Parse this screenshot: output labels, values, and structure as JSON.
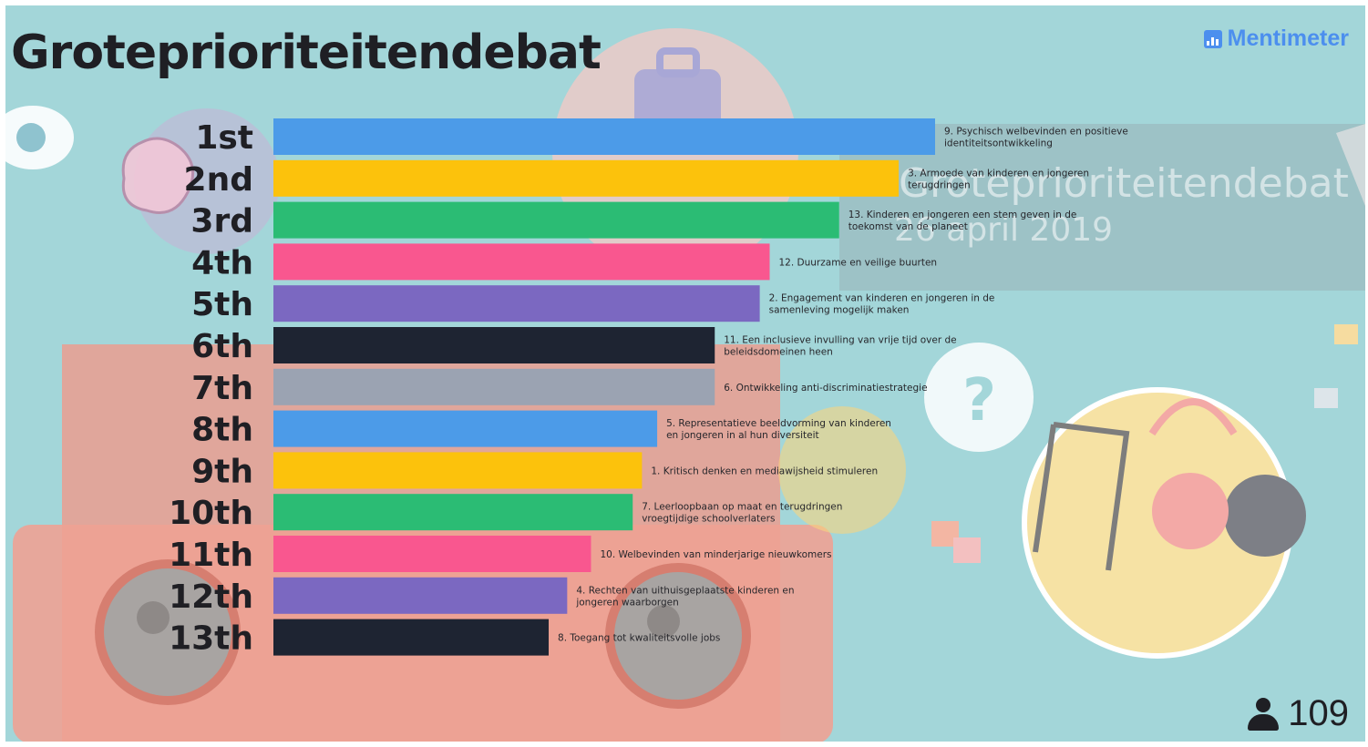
{
  "slide": {
    "title": "Groteprioriteitendebat",
    "background_title": "Groteprioriteitendebat",
    "background_date": "26 april 2019"
  },
  "branding": {
    "logo_text": "Mentimeter",
    "logo_icon": "bar-chart-icon",
    "color": "#4c8fee"
  },
  "participants": {
    "icon": "user-icon",
    "count": "109"
  },
  "chart_data": {
    "type": "bar",
    "orientation": "horizontal",
    "title": "Groteprioriteitendebat",
    "categories": [
      "1st",
      "2nd",
      "3rd",
      "4th",
      "5th",
      "6th",
      "7th",
      "8th",
      "9th",
      "10th",
      "11th",
      "12th",
      "13th"
    ],
    "labels": [
      [
        "9. Psychisch welbevinden en positieve",
        "identiteitsontwikkeling"
      ],
      [
        "3. Armoede van kinderen en jongeren",
        "terugdringen"
      ],
      [
        "13. Kinderen en jongeren een stem geven in de",
        "toekomst van de planeet"
      ],
      [
        "12. Duurzame en veilige buurten"
      ],
      [
        "2. Engagement van kinderen en jongeren in de",
        "samenleving mogelijk maken"
      ],
      [
        "11. Een inclusieve invulling van vrije tijd over de",
        "beleidsdomeinen heen"
      ],
      [
        "6. Ontwikkeling anti-discriminatiestrategie"
      ],
      [
        "5. Representatieve beeldvorming van kinderen",
        "en jongeren in al hun diversiteit"
      ],
      [
        "1. Kritisch denken en mediawijsheid stimuleren"
      ],
      [
        "7. Leerloopbaan op maat en terugdringen",
        "vroegtijdige schoolverlaters"
      ],
      [
        "10. Welbevinden van minderjarige nieuwkomers"
      ],
      [
        "4. Rechten van uithuisgeplaatste kinderen en",
        "jongeren waarborgen"
      ],
      [
        "8. Toegang tot kwaliteitsvolle jobs"
      ]
    ],
    "values": [
      100,
      94.5,
      85.5,
      75,
      73.5,
      66.7,
      66.7,
      58,
      55.7,
      54.3,
      48,
      44.4,
      41.6
    ],
    "colors": [
      "#4c9be8",
      "#fcc20c",
      "#2bbc74",
      "#f9578f",
      "#7b68c1",
      "#1e2432",
      "#9ba3b2",
      "#4c9be8",
      "#fcc20c",
      "#2bbc74",
      "#f9578f",
      "#7b68c1",
      "#1e2432"
    ],
    "xlim": [
      0,
      100
    ],
    "grid": false,
    "legend": "none"
  }
}
